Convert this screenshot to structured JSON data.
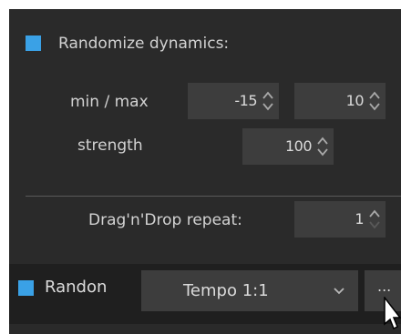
{
  "randomize_dynamics": {
    "checkbox_color": "#3aa1e6",
    "label": "Randomize dynamics:",
    "min_max_label": "min / max",
    "min_value": "-15",
    "max_value": "10",
    "strength_label": "strength",
    "strength_value": "100"
  },
  "drag_drop": {
    "label": "Drag'n'Drop repeat:",
    "value": "1"
  },
  "bottom": {
    "checkbox_color": "#3aa1e6",
    "label": "Randon",
    "tempo_select_value": "Tempo 1:1",
    "more_button_label": "..."
  },
  "icons": {
    "spinner": "up-down-chevron-icon",
    "select": "chevron-down-icon",
    "cursor": "mouse-pointer-icon"
  }
}
